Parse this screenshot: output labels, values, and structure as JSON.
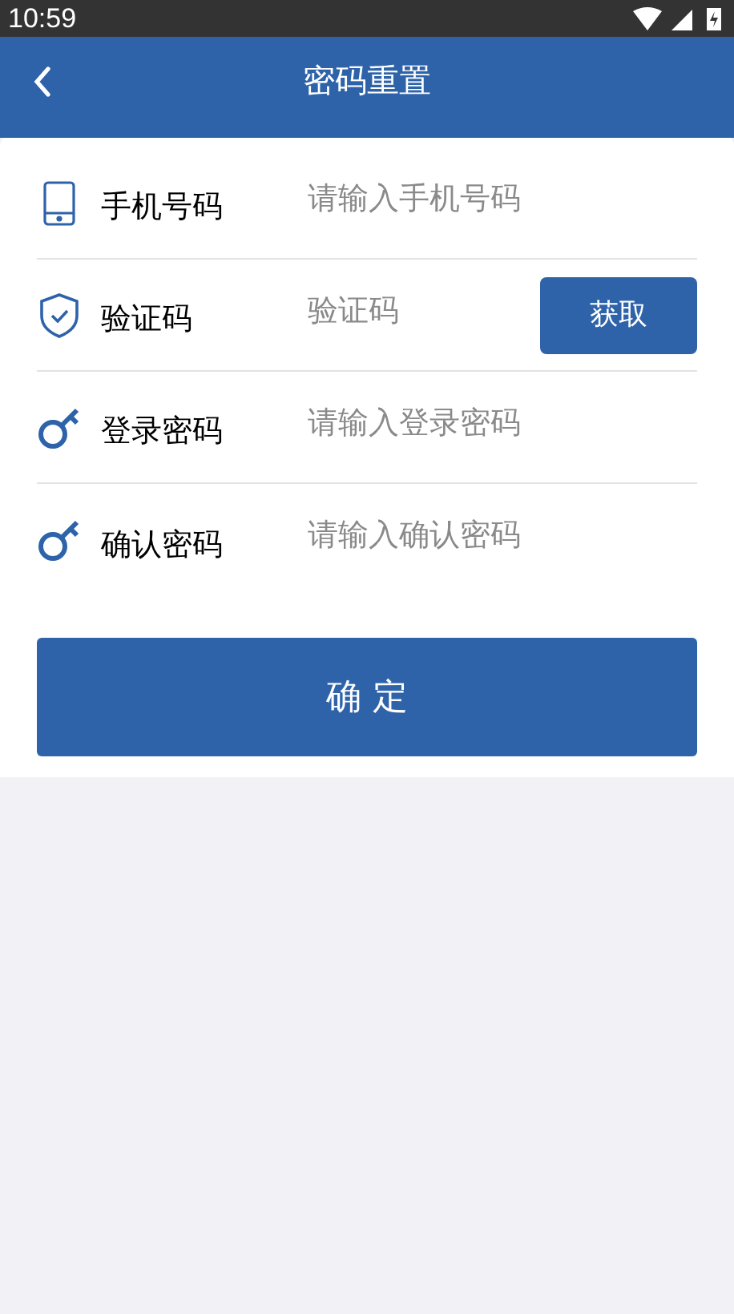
{
  "status_bar": {
    "time": "10:59"
  },
  "header": {
    "title": "密码重置"
  },
  "fields": [
    {
      "kind": "phone",
      "label": "手机号码",
      "placeholder": "请输入手机号码"
    },
    {
      "kind": "code",
      "label": "验证码",
      "placeholder": "验证码",
      "button": "获取"
    },
    {
      "kind": "password",
      "label": "登录密码",
      "placeholder": "请输入登录密码"
    },
    {
      "kind": "password",
      "label": "确认密码",
      "placeholder": "请输入确认密码"
    }
  ],
  "submit": "确 定"
}
